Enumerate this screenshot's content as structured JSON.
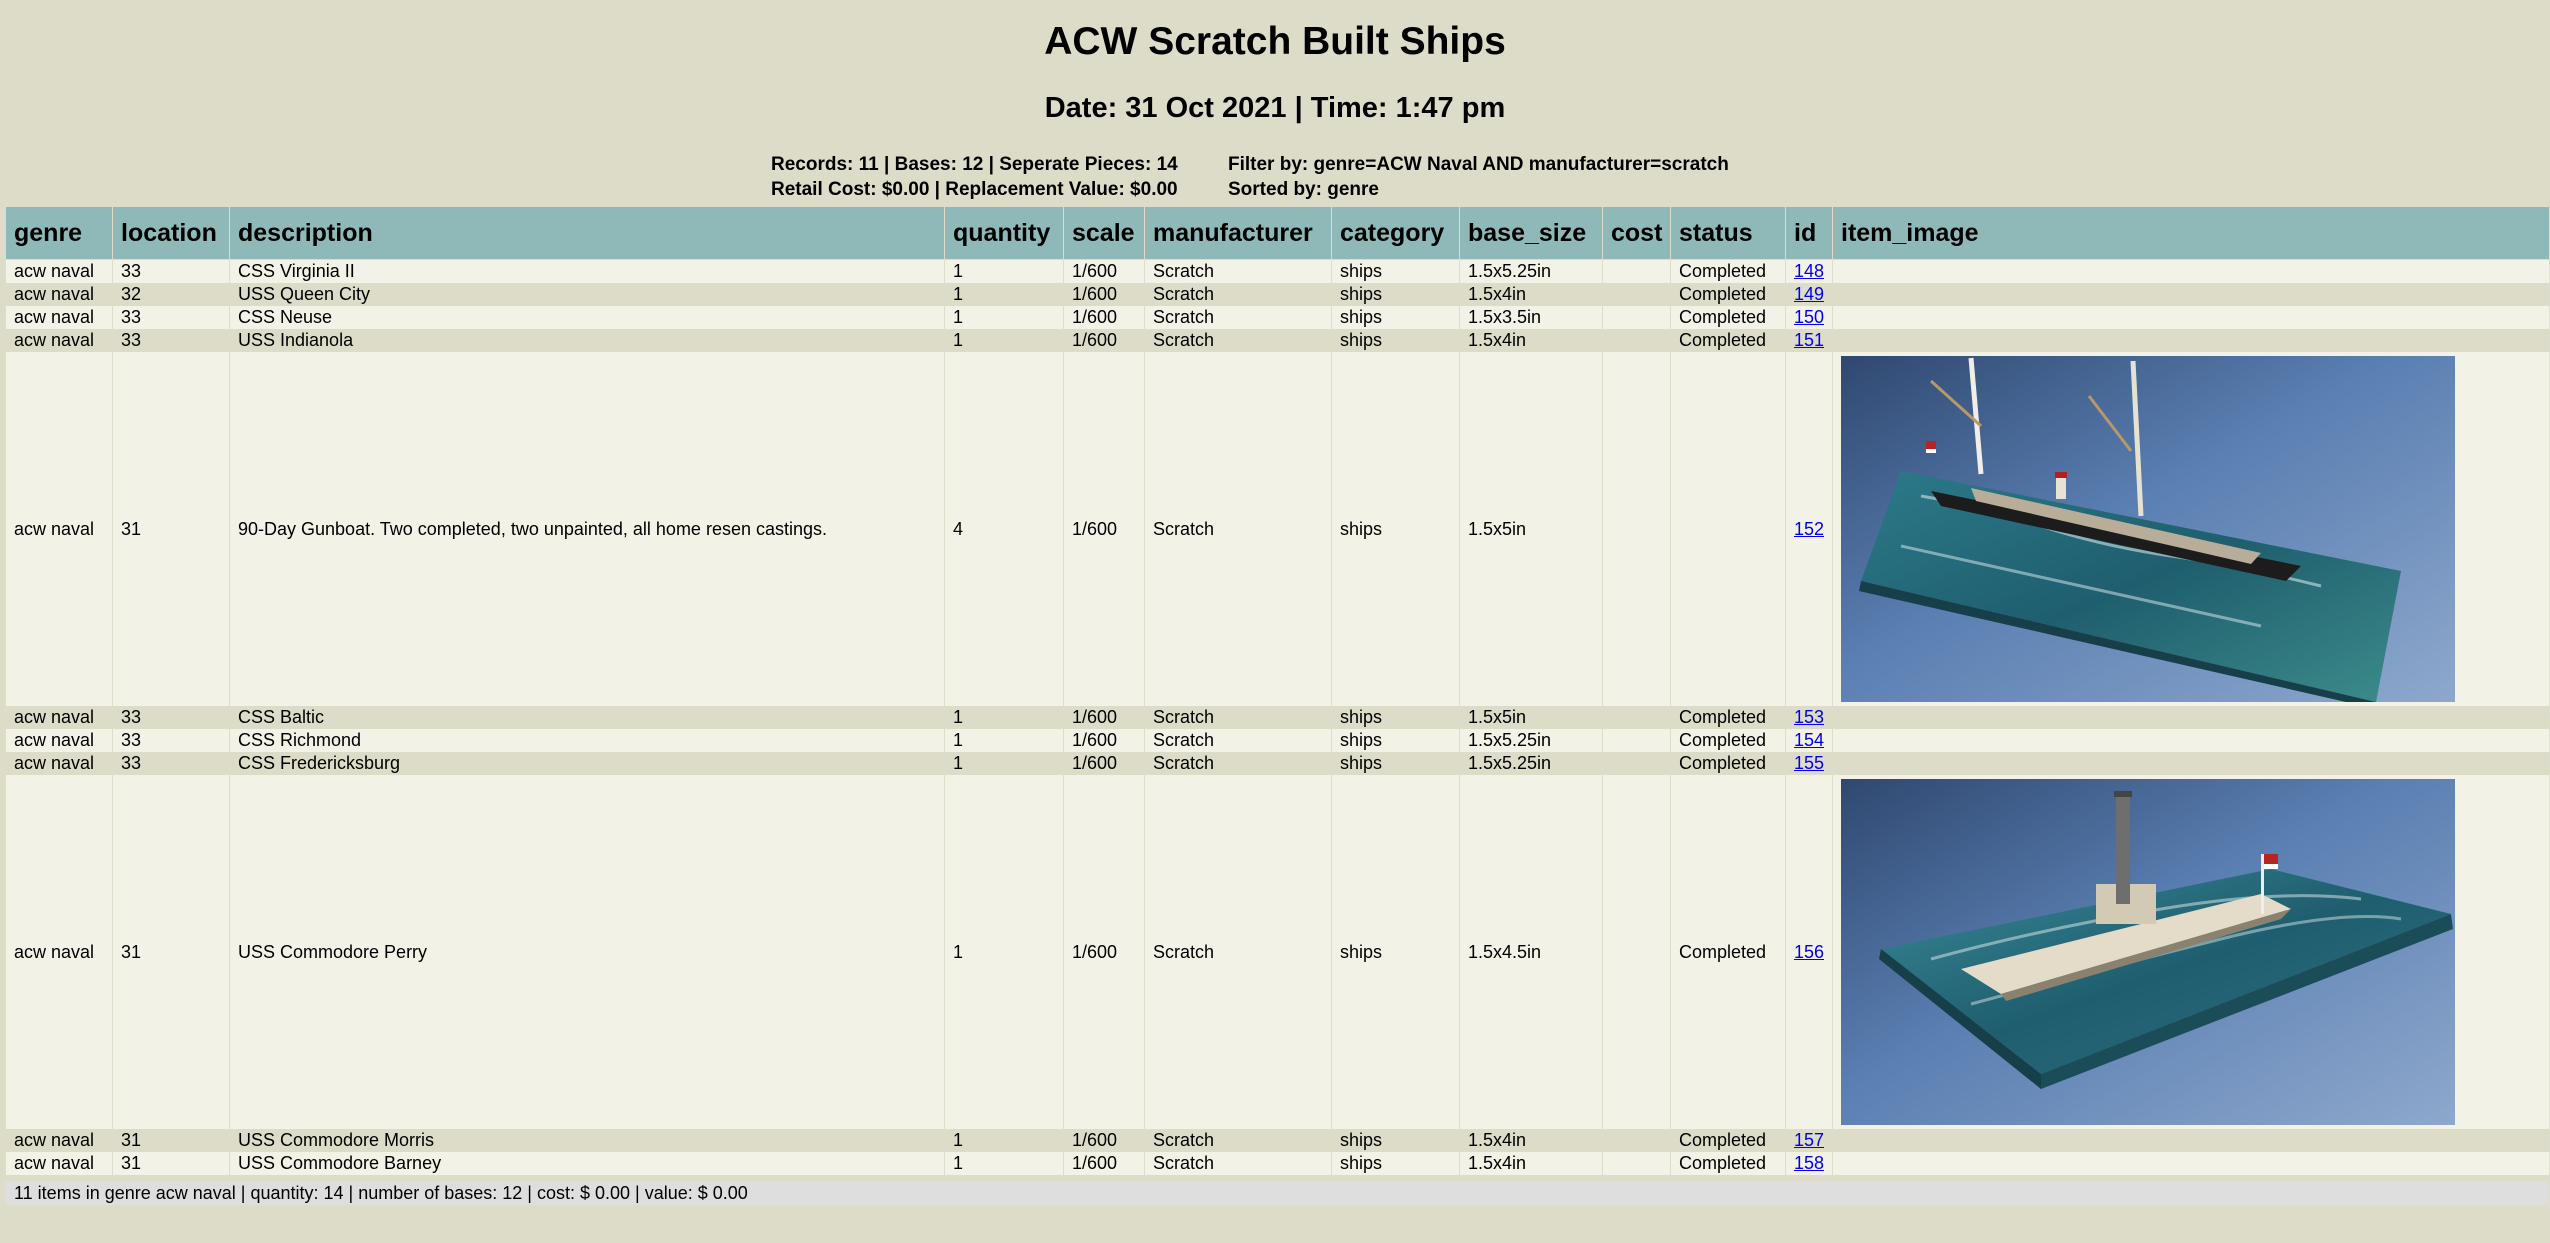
{
  "page": {
    "title": "ACW Scratch Built Ships",
    "subtitle": "Date: 31 Oct 2021 | Time: 1:47 pm"
  },
  "summary": {
    "line1_left": "Records: 11 | Bases: 12 | Seperate Pieces: 14",
    "line2_left": "Retail Cost: $0.00 | Replacement Value: $0.00",
    "line1_right": "Filter by: genre=ACW Naval AND manufacturer=scratch",
    "line2_right": "Sorted by: genre"
  },
  "table": {
    "headers": [
      "genre",
      "location",
      "description",
      "quantity",
      "scale",
      "manufacturer",
      "category",
      "base_size",
      "cost",
      "status",
      "id",
      "item_image"
    ],
    "rows": [
      {
        "genre": "acw naval",
        "location": "33",
        "description": "CSS Virginia II",
        "quantity": "1",
        "scale": "1/600",
        "manufacturer": "Scratch",
        "category": "ships",
        "base_size": "1.5x5.25in",
        "cost": "",
        "status": "Completed",
        "id": "148"
      },
      {
        "genre": "acw naval",
        "location": "32",
        "description": "USS Queen City",
        "quantity": "1",
        "scale": "1/600",
        "manufacturer": "Scratch",
        "category": "ships",
        "base_size": "1.5x4in",
        "cost": "",
        "status": "Completed",
        "id": "149"
      },
      {
        "genre": "acw naval",
        "location": "33",
        "description": "CSS Neuse",
        "quantity": "1",
        "scale": "1/600",
        "manufacturer": "Scratch",
        "category": "ships",
        "base_size": "1.5x3.5in",
        "cost": "",
        "status": "Completed",
        "id": "150"
      },
      {
        "genre": "acw naval",
        "location": "33",
        "description": "USS Indianola",
        "quantity": "1",
        "scale": "1/600",
        "manufacturer": "Scratch",
        "category": "ships",
        "base_size": "1.5x4in",
        "cost": "",
        "status": "Completed",
        "id": "151"
      },
      {
        "genre": "acw naval",
        "location": "31",
        "description": "90-Day Gunboat. Two completed, two unpainted, all home resen castings.",
        "quantity": "4",
        "scale": "1/600",
        "manufacturer": "Scratch",
        "category": "ships",
        "base_size": "1.5x5in",
        "cost": "",
        "status": "",
        "id": "152"
      },
      {
        "genre": "acw naval",
        "location": "33",
        "description": "CSS Baltic",
        "quantity": "1",
        "scale": "1/600",
        "manufacturer": "Scratch",
        "category": "ships",
        "base_size": "1.5x5in",
        "cost": "",
        "status": "Completed",
        "id": "153"
      },
      {
        "genre": "acw naval",
        "location": "33",
        "description": "CSS Richmond",
        "quantity": "1",
        "scale": "1/600",
        "manufacturer": "Scratch",
        "category": "ships",
        "base_size": "1.5x5.25in",
        "cost": "",
        "status": "Completed",
        "id": "154"
      },
      {
        "genre": "acw naval",
        "location": "33",
        "description": "CSS Fredericksburg",
        "quantity": "1",
        "scale": "1/600",
        "manufacturer": "Scratch",
        "category": "ships",
        "base_size": "1.5x5.25in",
        "cost": "",
        "status": "Completed",
        "id": "155"
      },
      {
        "genre": "acw naval",
        "location": "31",
        "description": "USS Commodore Perry",
        "quantity": "1",
        "scale": "1/600",
        "manufacturer": "Scratch",
        "category": "ships",
        "base_size": "1.5x4.5in",
        "cost": "",
        "status": "Completed",
        "id": "156"
      },
      {
        "genre": "acw naval",
        "location": "31",
        "description": "USS Commodore Morris",
        "quantity": "1",
        "scale": "1/600",
        "manufacturer": "Scratch",
        "category": "ships",
        "base_size": "1.5x4in",
        "cost": "",
        "status": "Completed",
        "id": "157"
      },
      {
        "genre": "acw naval",
        "location": "31",
        "description": "USS Commodore Barney",
        "quantity": "1",
        "scale": "1/600",
        "manufacturer": "Scratch",
        "category": "ships",
        "base_size": "1.5x4in",
        "cost": "",
        "status": "Completed",
        "id": "158"
      }
    ]
  },
  "footer": {
    "text": "11 items in genre acw naval | quantity: 14 | number of bases: 12 | cost: $ 0.00 | value: $ 0.00"
  },
  "colors": {
    "page_background": "#dddcc8",
    "header_background": "#8fb8b8",
    "row_light": "#f3f2e7",
    "row_dark": "#dddcc8",
    "link": "#0000ee"
  }
}
